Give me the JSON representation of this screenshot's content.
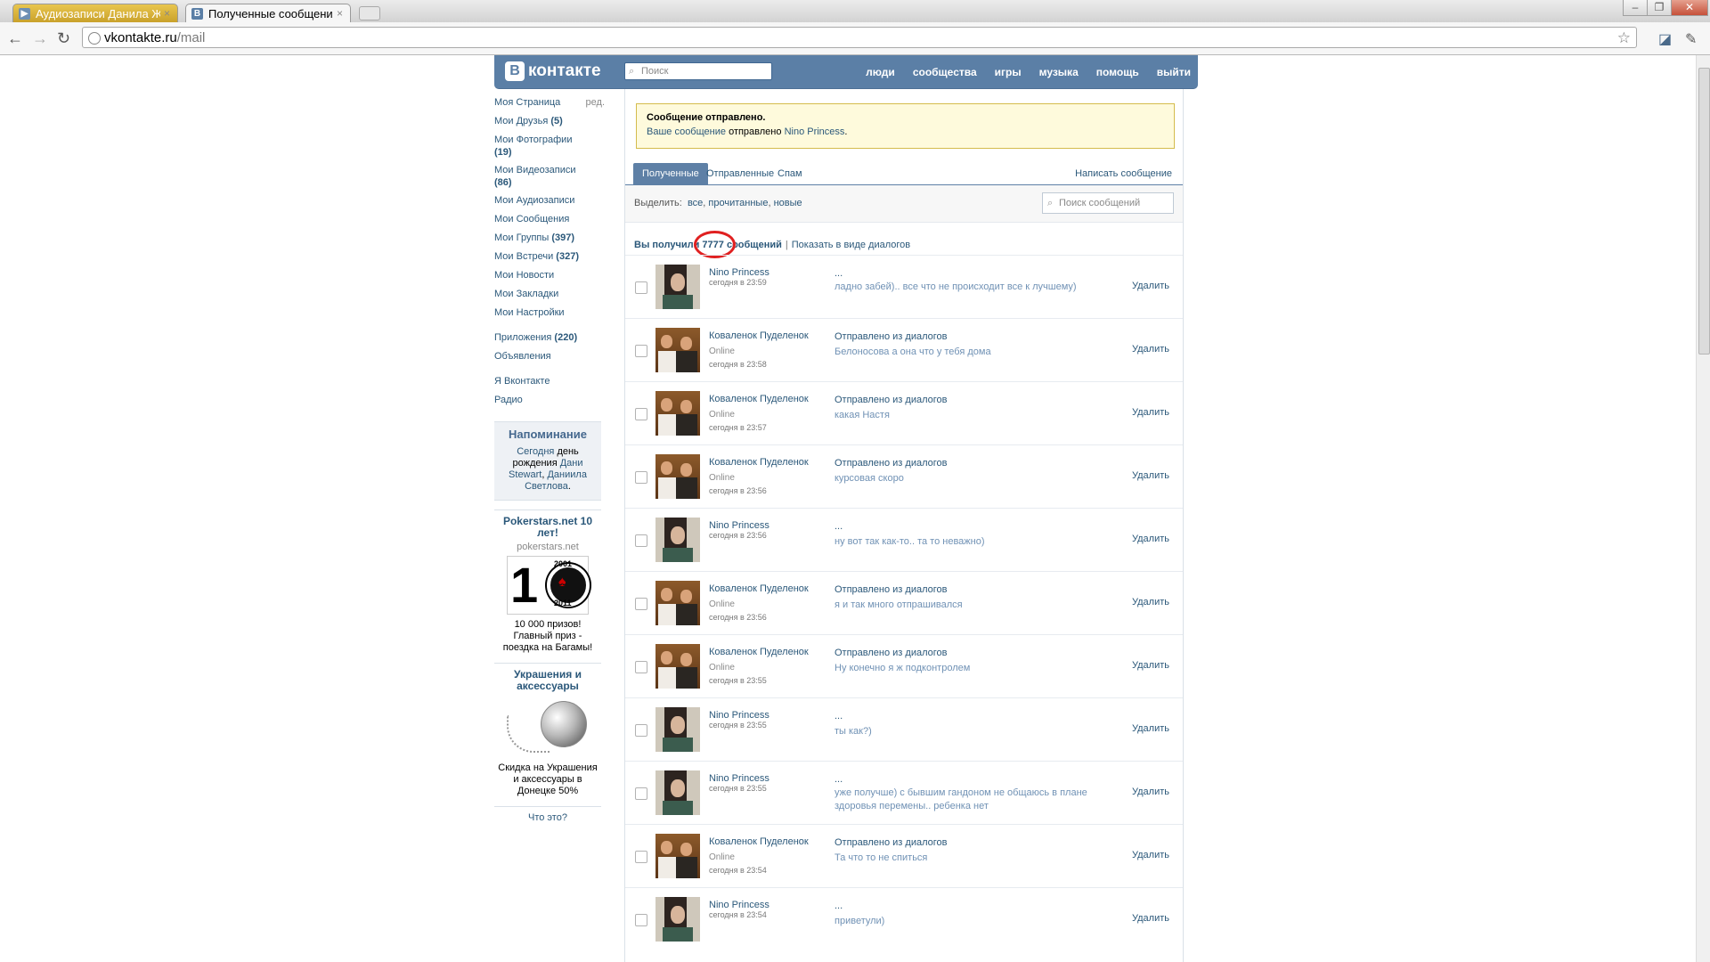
{
  "browser": {
    "tabs": [
      {
        "title": "Аудиозаписи Данила Жив",
        "close": "×"
      },
      {
        "title": "Полученные сообщения",
        "close": "×"
      }
    ],
    "url_host": "vkontakte.ru",
    "url_path": "/mail",
    "icons": [
      "back-arrow-icon",
      "forward-arrow-icon",
      "reload-icon",
      "bookmark-star-icon",
      "extension-icon",
      "wrench-icon"
    ]
  },
  "header": {
    "logo": "контакте",
    "logo_mark": "B",
    "search_placeholder": "Поиск",
    "nav": [
      "люди",
      "сообщества",
      "игры",
      "музыка",
      "помощь",
      "выйти"
    ]
  },
  "sidebar": {
    "edit": "ред.",
    "items": [
      {
        "label": "Моя Страница",
        "count": ""
      },
      {
        "label": "Мои Друзья",
        "count": "(5)"
      },
      {
        "label": "Мои Фотографии",
        "count": "(19)"
      },
      {
        "label": "Мои Видеозаписи",
        "count": "(86)"
      },
      {
        "label": "Мои Аудиозаписи",
        "count": ""
      },
      {
        "label": "Мои Сообщения",
        "count": ""
      },
      {
        "label": "Мои Группы",
        "count": "(397)"
      },
      {
        "label": "Мои Встречи",
        "count": "(327)"
      },
      {
        "label": "Мои Новости",
        "count": ""
      },
      {
        "label": "Мои Закладки",
        "count": ""
      },
      {
        "label": "Мои Настройки",
        "count": ""
      },
      {
        "label": "Приложения",
        "count": "(220)"
      },
      {
        "label": "Объявления",
        "count": ""
      },
      {
        "label": "Я Вконтакте",
        "count": ""
      },
      {
        "label": "Радио",
        "count": ""
      }
    ],
    "reminder": {
      "title": "Напоминание",
      "text1": "Сегодня",
      "text2": "день рождения",
      "name1": "Дани Stewart",
      "comma": ",",
      "name2": "Даниила Светлова",
      "dot": "."
    },
    "ads": [
      {
        "title": "Pokerstars.net 10 лет!",
        "domain": "pokerstars.net",
        "year_top": "2001",
        "year_bottom": "2011",
        "desc": "10 000 призов! Главный приз - поездка на Багамы!"
      },
      {
        "title": "Украшения и аксессуары",
        "domain": "",
        "desc": "Скидка на Украшения и аксессуары в Донецке 50%"
      }
    ],
    "what_is": "Что это?"
  },
  "notice": {
    "title": "Сообщение отправлено.",
    "link": "Ваше сообщение",
    "mid": "отправлено",
    "recipient": "Nino Princess",
    "end": "."
  },
  "tabs": {
    "received": "Полученные",
    "sent": "Отправленные",
    "spam": "Спам",
    "write": "Написать сообщение"
  },
  "filter": {
    "label": "Выделить:",
    "all": "все",
    "read": "прочитанные",
    "new": "новые",
    "search_placeholder": "Поиск сообщений"
  },
  "summary": {
    "prefix": "Вы получили",
    "count": "7777",
    "suffix": "сообщений",
    "separator": "|",
    "dialogs": "Показать в виде диалогов"
  },
  "messages": [
    {
      "name": "Nino Princess",
      "status": "",
      "date": "сегодня в 23:59",
      "title": "...",
      "preview": "ладно забей).. все что не происходит все к лучшему)",
      "avatar": "nino",
      "delete": "Удалить"
    },
    {
      "name": "Коваленок Пуделенок",
      "status": "Online",
      "date": "сегодня в 23:58",
      "title": "Отправлено из диалогов",
      "preview": "Белоносова а она что у тебя дома",
      "avatar": "kov",
      "delete": "Удалить"
    },
    {
      "name": "Коваленок Пуделенок",
      "status": "Online",
      "date": "сегодня в 23:57",
      "title": "Отправлено из диалогов",
      "preview": "какая Настя",
      "avatar": "kov",
      "delete": "Удалить"
    },
    {
      "name": "Коваленок Пуделенок",
      "status": "Online",
      "date": "сегодня в 23:56",
      "title": "Отправлено из диалогов",
      "preview": "курсовая скоро",
      "avatar": "kov",
      "delete": "Удалить"
    },
    {
      "name": "Nino Princess",
      "status": "",
      "date": "сегодня в 23:56",
      "title": "...",
      "preview": "ну вот так как-то.. та то неважно)",
      "avatar": "nino",
      "delete": "Удалить"
    },
    {
      "name": "Коваленок Пуделенок",
      "status": "Online",
      "date": "сегодня в 23:56",
      "title": "Отправлено из диалогов",
      "preview": "я и так много отпрашивался",
      "avatar": "kov",
      "delete": "Удалить"
    },
    {
      "name": "Коваленок Пуделенок",
      "status": "Online",
      "date": "сегодня в 23:55",
      "title": "Отправлено из диалогов",
      "preview": "Ну конечно я ж подконтролем",
      "avatar": "kov",
      "delete": "Удалить"
    },
    {
      "name": "Nino Princess",
      "status": "",
      "date": "сегодня в 23:55",
      "title": "...",
      "preview": "ты как?)",
      "avatar": "nino",
      "delete": "Удалить"
    },
    {
      "name": "Nino Princess",
      "status": "",
      "date": "сегодня в 23:55",
      "title": "...",
      "preview": "уже получше) с бывшим гандоном не общаюсь в плане здоровья перемены.. ребенка нет",
      "avatar": "nino",
      "delete": "Удалить"
    },
    {
      "name": "Коваленок Пуделенок",
      "status": "Online",
      "date": "сегодня в 23:54",
      "title": "Отправлено из диалогов",
      "preview": "Та что то не спиться",
      "avatar": "kov",
      "delete": "Удалить"
    },
    {
      "name": "Nino Princess",
      "status": "",
      "date": "сегодня в 23:54",
      "title": "...",
      "preview": "приветули)",
      "avatar": "nino",
      "delete": "Удалить"
    }
  ],
  "colors": {
    "vk_blue": "#5b7fa6",
    "link": "#2b587a",
    "notice_bg": "#fefadc",
    "highlight_circle": "#e02020"
  }
}
